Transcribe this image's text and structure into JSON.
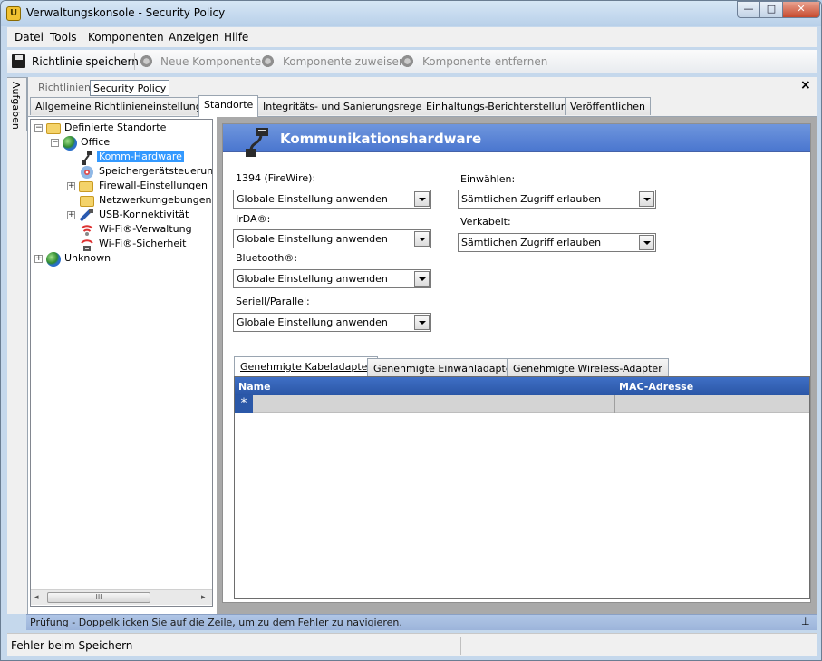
{
  "window": {
    "title": "Verwaltungskonsole - Security Policy",
    "icon_glyph": "U",
    "controls": {
      "minimize": "—",
      "maximize": "□",
      "close": "✕"
    }
  },
  "menu": [
    "Datei",
    "Tools",
    "Komponenten",
    "Anzeigen",
    "Hilfe"
  ],
  "toolbar": {
    "save": "Richtlinie speichern",
    "new_component": "Neue Komponente",
    "assign_component": "Komponente zuweisen",
    "remove_component": "Komponente entfernen"
  },
  "side_panel": {
    "label": "Aufgaben"
  },
  "doc_tabs": [
    "Richtlinien",
    "Security Policy"
  ],
  "close_glyph": "×",
  "policy_tabs": [
    "Allgemeine Richtlinieneinstellungen",
    "Standorte",
    "Integritäts- und Sanierungsregeln",
    "Einhaltungs-Berichterstellung",
    "Veröffentlichen"
  ],
  "tree": {
    "root": "Definierte Standorte",
    "office": "Office",
    "children": [
      "Komm-Hardware",
      "Speichergerätsteuerun",
      "Firewall-Einstellungen",
      "Netzwerkumgebungen",
      "USB-Konnektivität",
      "Wi-Fi®-Verwaltung",
      "Wi-Fi®-Sicherheit"
    ],
    "unknown": "Unknown",
    "expand_glyph": "+",
    "collapse_glyph": "−",
    "scroll": {
      "left": "◂",
      "right": "▸",
      "thumb": "III"
    }
  },
  "detail": {
    "title": "Kommunikationshardware",
    "fields": [
      {
        "label": "1394 (FireWire):",
        "value": "Globale Einstellung anwenden"
      },
      {
        "label": "IrDA®:",
        "value": "Globale Einstellung anwenden"
      },
      {
        "label": "Bluetooth®:",
        "value": "Globale Einstellung anwenden"
      },
      {
        "label": "Seriell/Parallel:",
        "value": "Globale Einstellung anwenden"
      },
      {
        "label": "Einwählen:",
        "value": "Sämtlichen Zugriff erlauben"
      },
      {
        "label": "Verkabelt:",
        "value": "Sämtlichen Zugriff erlauben"
      }
    ],
    "adapter_tabs": [
      "Genehmigte Kabeladapter",
      "Genehmigte Einwähladapter",
      "Genehmigte Wireless-Adapter"
    ],
    "grid": {
      "columns": [
        "Name",
        "MAC-Adresse"
      ],
      "new_row_marker": "*"
    }
  },
  "error_panel": {
    "text": "Prüfung - Doppelklicken Sie auf die Zeile, um zu dem Fehler zu navigieren.",
    "pin_glyph": "⊥"
  },
  "status": "Fehler beim Speichern",
  "colors": {
    "header_blue": "#4a76cf",
    "selection": "#3399ff",
    "grid_header": "#2a56a6",
    "title_bar": "#b8d0e9"
  }
}
